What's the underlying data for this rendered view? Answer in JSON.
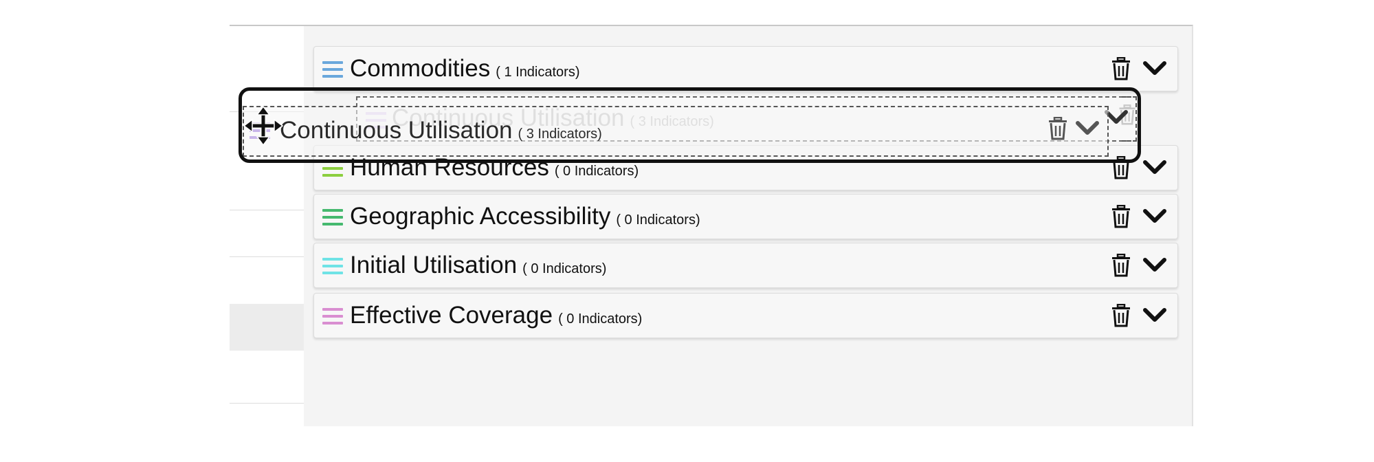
{
  "list": {
    "rows": [
      {
        "name": "Commodities",
        "count": "( 1 Indicators)",
        "color": "#6aa7dc"
      },
      {
        "name": "Human Resources",
        "count": "( 0 Indicators)",
        "color": "#8ccf3f"
      },
      {
        "name": "Geographic Accessibility",
        "count": "( 0 Indicators)",
        "color": "#46b96f"
      },
      {
        "name": "Initial Utilisation",
        "count": "( 0 Indicators)",
        "color": "#6fe3e6"
      },
      {
        "name": "Effective Coverage",
        "count": "( 0 Indicators)",
        "color": "#d98ed1"
      }
    ],
    "dragged": {
      "name": "Continuous Utilisation",
      "count": "( 3 Indicators)",
      "color": "#c9b6ea"
    }
  },
  "icons": {
    "row_actions": [
      "trash-icon",
      "chevron-down-icon"
    ],
    "drag_cursor": "move-cursor-icon"
  }
}
